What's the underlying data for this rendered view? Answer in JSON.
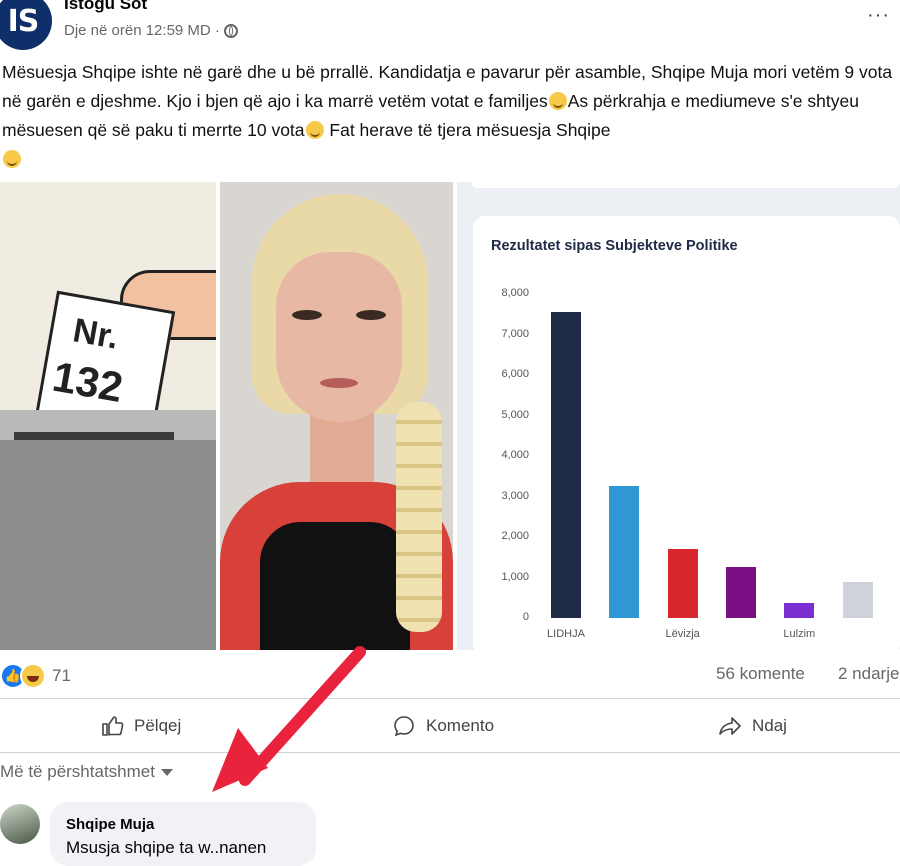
{
  "header": {
    "page_name": "Istogu Sot",
    "logo_text": "IS",
    "timestamp": "Dje në orën 12:59 MD ·",
    "more": "···"
  },
  "post": {
    "text_1": "Mësuesja Shqipe ishte në garë dhe u bë prrallë. Kandidatja e pavarur për asamble, Shqipe Muja mori vetëm 9 vota në garën e djeshme. Kjo i bjen që ajo i ka marrë vetëm votat e familjes",
    "text_2": "As përkrahja e mediumeve s'e shtyeu mësuesen që së paku ti merrte 10 vota",
    "text_3": " Fat herave të tjera mësuesja Shqipe"
  },
  "image_left": {
    "ballot_line1": "Nr.",
    "ballot_line2": "132"
  },
  "chart_data": {
    "type": "bar",
    "title": "Rezultatet sipas Subjekteve Politike",
    "yticks": [
      "8,000",
      "7,000",
      "6,000",
      "5,000",
      "4,000",
      "3,000",
      "2,000",
      "1,000",
      "0"
    ],
    "ylim": [
      0,
      8000
    ],
    "categories": [
      "LIDHJA DEMOKRATIKE",
      "",
      "Lëvizja VETËVENDOSJE!",
      "",
      "Lulzim Shashi",
      ""
    ],
    "visible_labels": [
      "LIDHJA",
      "Lëvizja",
      "Lulzim"
    ],
    "values": [
      7550,
      3250,
      1700,
      1260,
      380,
      880
    ],
    "colors": [
      "#1f2a44",
      "#2f98d5",
      "#d8262e",
      "#7b0f84",
      "#7b2fd0",
      "#cfd2da"
    ]
  },
  "engagement": {
    "reaction_count": "71",
    "comments": "56 komente",
    "shares": "2 ndarje"
  },
  "actions": {
    "like": "Pëlqej",
    "comment": "Komento",
    "share": "Ndaj"
  },
  "sort": {
    "label": "Më të përshtatshmet"
  },
  "comment": {
    "author": "Shqipe Muja",
    "text": "Msusja shqipe ta w..nanen"
  },
  "colors": {
    "accent": "#1877f2",
    "arrow": "#e8233b"
  }
}
